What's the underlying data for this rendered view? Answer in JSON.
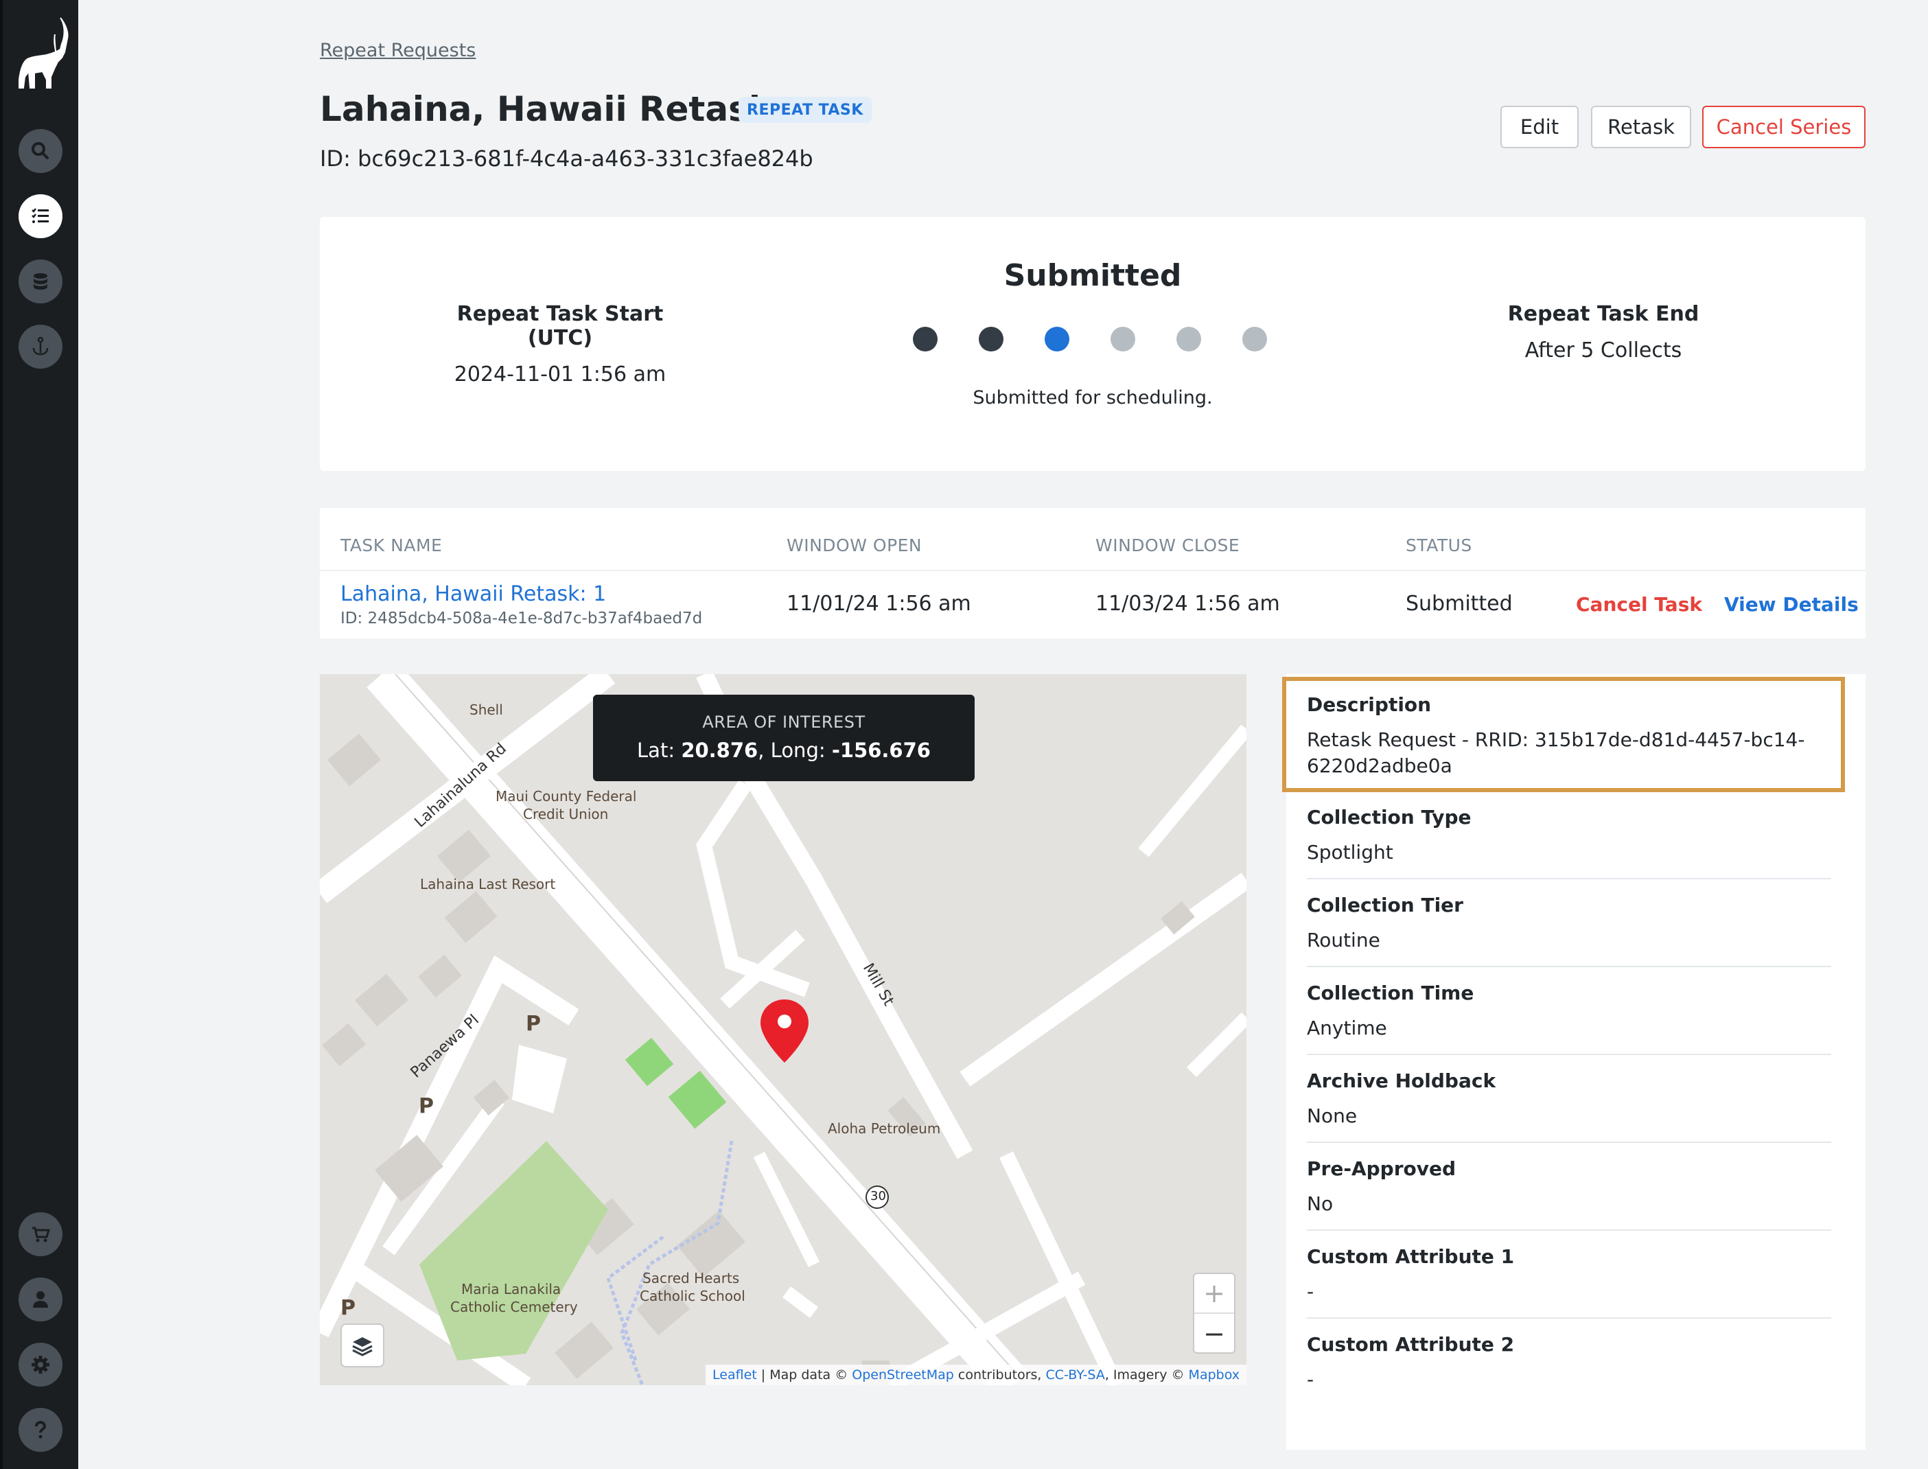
{
  "nav": {
    "items": [
      "search-icon",
      "list-icon",
      "database-icon",
      "anchor-icon",
      "cart-icon",
      "user-icon",
      "gear-icon",
      "help-icon"
    ],
    "active": "list-icon"
  },
  "breadcrumb": "Repeat Requests",
  "title": "Lahaina, Hawaii Retask",
  "badge": "REPEAT TASK",
  "id_line": "ID: bc69c213-681f-4c4a-a463-331c3fae824b",
  "buttons": {
    "edit": "Edit",
    "retask": "Retask",
    "cancel_series": "Cancel Series"
  },
  "status": {
    "title": "Submitted",
    "subtitle": "Submitted for scheduling.",
    "start_label": "Repeat Task Start (UTC)",
    "start_value": "2024-11-01 1:56 am",
    "end_label": "Repeat Task End",
    "end_value": "After 5 Collects",
    "steps_total": 6,
    "steps_completed": 2,
    "current_step": 3,
    "colors": {
      "done": "#343d45",
      "current": "#1f72d6",
      "pending": "#b5bcc2"
    }
  },
  "table": {
    "headers": [
      "TASK NAME",
      "WINDOW OPEN",
      "WINDOW CLOSE",
      "STATUS"
    ],
    "row": {
      "name": "Lahaina, Hawaii Retask: 1",
      "id": "ID: 2485dcb4-508a-4e1e-8d7c-b37af4baed7d",
      "window_open": "11/01/24 1:56 am",
      "window_close": "11/03/24 1:56 am",
      "status": "Submitted",
      "cancel": "Cancel Task",
      "view": "View Details"
    }
  },
  "map": {
    "tooltip_title": "AREA OF INTEREST",
    "lat_label": "Lat: ",
    "lat": "20.876",
    "long_label": ", Long: ",
    "long": "-156.676",
    "labels": {
      "shell": "Shell",
      "credit_union_1": "Maui County Federal",
      "credit_union_2": "Credit Union",
      "resort": "Lahaina Last Resort",
      "aloha": "Aloha Petroleum",
      "cemetery_1": "Maria Lanakila",
      "cemetery_2": "Catholic Cemetery",
      "school_1": "Sacred Hearts",
      "school_2": "Catholic School",
      "lahainaluna": "Lahainaluna Rd",
      "panaewa": "Panaewa Pl",
      "mill": "Mill St",
      "route": "30",
      "parking": "P"
    },
    "zoom_in": "+",
    "zoom_out": "−",
    "attribution": {
      "leaflet": "Leaflet",
      "sep1": " | Map data © ",
      "osm": "OpenStreetMap",
      "mid": " contributors, ",
      "license": "CC-BY-SA",
      "img": ", Imagery © ",
      "mapbox": "Mapbox"
    }
  },
  "details": [
    {
      "label": "Description",
      "value": "Retask Request - RRID: 315b17de-d81d-4457-bc14-6220d2adbe0a"
    },
    {
      "label": "Collection Type",
      "value": "Spotlight"
    },
    {
      "label": "Collection Tier",
      "value": "Routine"
    },
    {
      "label": "Collection Time",
      "value": "Anytime"
    },
    {
      "label": "Archive Holdback",
      "value": "None"
    },
    {
      "label": "Pre-Approved",
      "value": "No"
    },
    {
      "label": "Custom Attribute 1",
      "value": "-"
    },
    {
      "label": "Custom Attribute 2",
      "value": "-"
    }
  ]
}
